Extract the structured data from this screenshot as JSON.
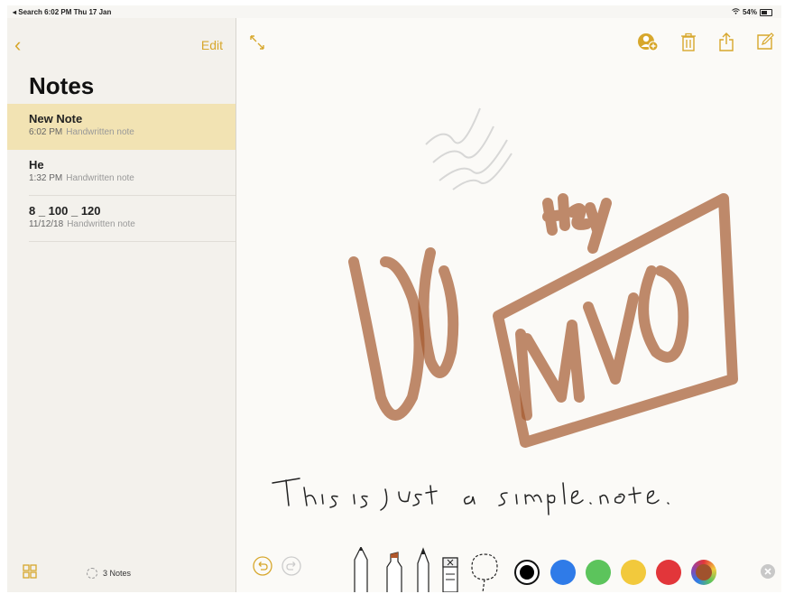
{
  "status_bar": {
    "left": "◂ Search  6:02 PM  Thu 17 Jan",
    "battery": "54%"
  },
  "sidebar": {
    "edit_label": "Edit",
    "title": "Notes",
    "notes": [
      {
        "title": "New Note",
        "time": "6:02 PM",
        "kind": "Handwritten note",
        "selected": true
      },
      {
        "title": "He",
        "time": "1:32 PM",
        "kind": "Handwritten note",
        "selected": false
      },
      {
        "title": "8 _ 100 _ 120",
        "time": "11/12/18",
        "kind": "Handwritten note",
        "selected": false
      }
    ],
    "count_label": "3 Notes"
  },
  "note": {
    "handwritten_text": "This is just a simple note.",
    "drawing_words": [
      "Hey",
      "MVO"
    ]
  },
  "tool_palette": {
    "colors": [
      "#000000",
      "#2f7be8",
      "#5cc45c",
      "#f2c93c",
      "#e2363a",
      "#a0522d"
    ],
    "selected_color": "#000000",
    "accent": "#d7a72c"
  }
}
